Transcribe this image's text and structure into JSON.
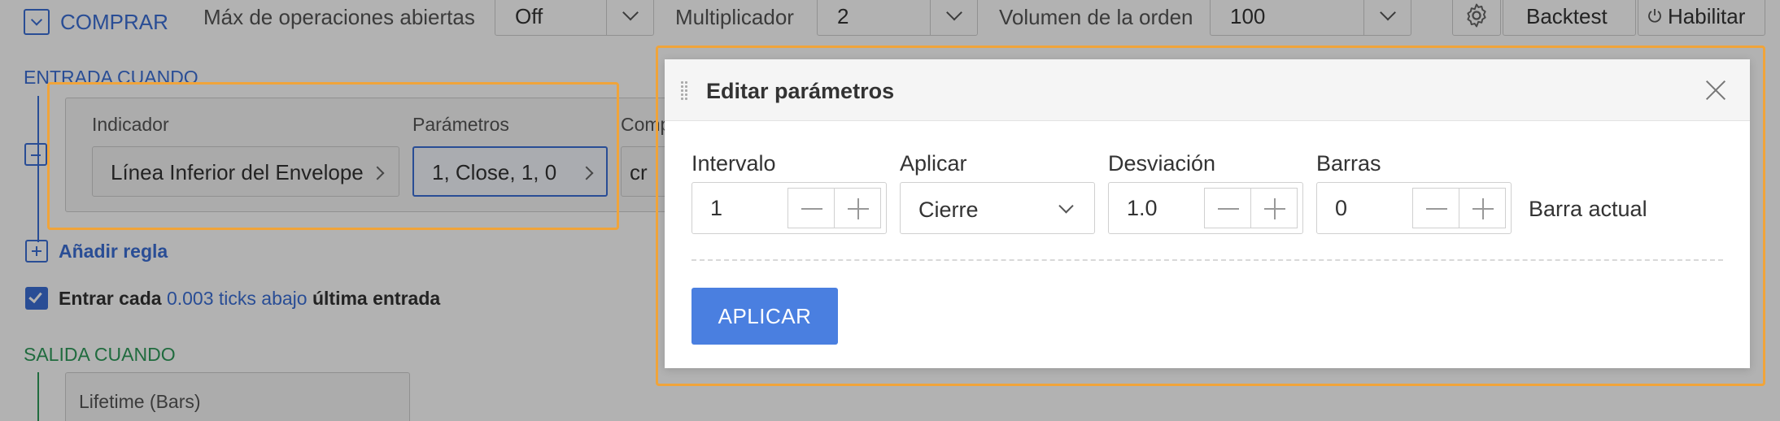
{
  "toolbar": {
    "direction_label": "COMPRAR",
    "max_open_label": "Máx de operaciones abiertas",
    "max_open_value": "Off",
    "multiplier_label": "Multiplicador",
    "multiplier_value": "2",
    "volume_label": "Volumen de la orden",
    "volume_value": "100",
    "backtest_label": "Backtest",
    "enable_label": "Habilitar"
  },
  "entry": {
    "section_title": "ENTRADA CUANDO",
    "indicator_header": "Indicador",
    "indicator_value": "Línea Inferior del Envelope",
    "params_header": "Parámetros",
    "params_value": "1, Close, 1, 0",
    "compare_header": "Comp",
    "compare_value": "cr",
    "add_rule": "Añadir regla",
    "every_prefix": "Entrar cada",
    "every_link": "0.003 ticks abajo",
    "every_suffix": "última entrada"
  },
  "exit": {
    "section_title": "SALIDA CUANDO",
    "field_value": "Lifetime (Bars)"
  },
  "modal": {
    "title": "Editar parámetros",
    "fields": [
      {
        "label": "Intervalo",
        "value": "1"
      },
      {
        "label": "Aplicar",
        "value": "Cierre"
      },
      {
        "label": "Desviación",
        "value": "1.0"
      },
      {
        "label": "Barras",
        "value": "0"
      }
    ],
    "bars_suffix": "Barra actual",
    "apply_label": "APLICAR"
  },
  "colors": {
    "accent": "#4a7fe0",
    "highlight": "#f0a43a",
    "section_blue": "#3b6fd6",
    "section_green": "#2e9a5a"
  }
}
